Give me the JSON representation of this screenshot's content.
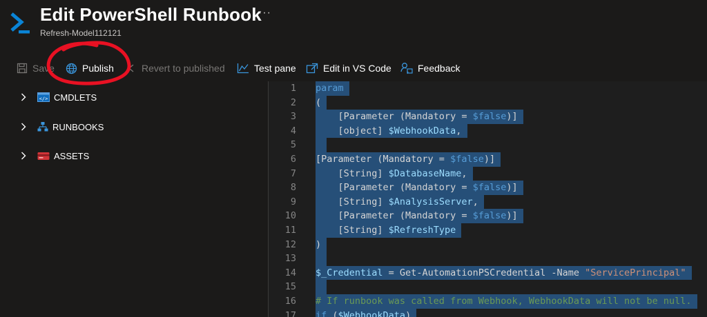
{
  "header": {
    "title": "Edit PowerShell Runbook",
    "subtitle": "Refresh-Model112121",
    "more": "···"
  },
  "toolbar": {
    "save_label": "Save",
    "publish_label": "Publish",
    "revert_label": "Revert to published",
    "test_pane_label": "Test pane",
    "edit_vscode_label": "Edit in VS Code",
    "feedback_label": "Feedback"
  },
  "sidebar": {
    "items": [
      {
        "label": "CMDLETS",
        "icon": "cmdlets-icon"
      },
      {
        "label": "RUNBOOKS",
        "icon": "runbooks-icon"
      },
      {
        "label": "ASSETS",
        "icon": "assets-icon"
      }
    ]
  },
  "editor": {
    "lines": [
      {
        "n": "1",
        "tokens": [
          {
            "t": "param",
            "c": "kw"
          }
        ]
      },
      {
        "n": "2",
        "tokens": [
          {
            "t": "(",
            "c": ""
          }
        ]
      },
      {
        "n": "3",
        "tokens": [
          {
            "t": "    [Parameter (Mandatory = ",
            "c": ""
          },
          {
            "t": "$false",
            "c": "kw"
          },
          {
            "t": ")]",
            "c": ""
          }
        ]
      },
      {
        "n": "4",
        "tokens": [
          {
            "t": "    [object] ",
            "c": ""
          },
          {
            "t": "$WebhookData",
            "c": "var"
          },
          {
            "t": ",",
            "c": ""
          }
        ]
      },
      {
        "n": "5",
        "tokens": [
          {
            "t": "",
            "c": ""
          }
        ]
      },
      {
        "n": "6",
        "tokens": [
          {
            "t": "[Parameter (Mandatory = ",
            "c": ""
          },
          {
            "t": "$false",
            "c": "kw"
          },
          {
            "t": ")]",
            "c": ""
          }
        ]
      },
      {
        "n": "7",
        "tokens": [
          {
            "t": "    [String] ",
            "c": ""
          },
          {
            "t": "$DatabaseName",
            "c": "var"
          },
          {
            "t": ",",
            "c": ""
          }
        ]
      },
      {
        "n": "8",
        "tokens": [
          {
            "t": "    [Parameter (Mandatory = ",
            "c": ""
          },
          {
            "t": "$false",
            "c": "kw"
          },
          {
            "t": ")]",
            "c": ""
          }
        ]
      },
      {
        "n": "9",
        "tokens": [
          {
            "t": "    [String] ",
            "c": ""
          },
          {
            "t": "$AnalysisServer",
            "c": "var"
          },
          {
            "t": ",",
            "c": ""
          }
        ]
      },
      {
        "n": "10",
        "tokens": [
          {
            "t": "    [Parameter (Mandatory = ",
            "c": ""
          },
          {
            "t": "$false",
            "c": "kw"
          },
          {
            "t": ")]",
            "c": ""
          }
        ]
      },
      {
        "n": "11",
        "tokens": [
          {
            "t": "    [String] ",
            "c": ""
          },
          {
            "t": "$RefreshType",
            "c": "var"
          }
        ]
      },
      {
        "n": "12",
        "tokens": [
          {
            "t": ")",
            "c": ""
          }
        ]
      },
      {
        "n": "13",
        "tokens": [
          {
            "t": "",
            "c": ""
          }
        ]
      },
      {
        "n": "14",
        "tokens": [
          {
            "t": "$_Credential",
            "c": "var"
          },
          {
            "t": " = Get-AutomationPSCredential -Name ",
            "c": ""
          },
          {
            "t": "\"ServicePrincipal\"",
            "c": "str"
          }
        ]
      },
      {
        "n": "15",
        "tokens": [
          {
            "t": "",
            "c": ""
          }
        ]
      },
      {
        "n": "16",
        "tokens": [
          {
            "t": "# If runbook was called from Webhook, WebhookData will not be null.",
            "c": "cmt"
          }
        ]
      },
      {
        "n": "17",
        "tokens": [
          {
            "t": "if",
            "c": "kw"
          },
          {
            "t": " (",
            "c": ""
          },
          {
            "t": "$WebhookData",
            "c": "var"
          },
          {
            "t": ")",
            "c": ""
          }
        ]
      }
    ]
  },
  "colors": {
    "background": "#1b1a19",
    "accent": "#0078d4",
    "selection": "#264f78",
    "annotation": "#e81123"
  }
}
